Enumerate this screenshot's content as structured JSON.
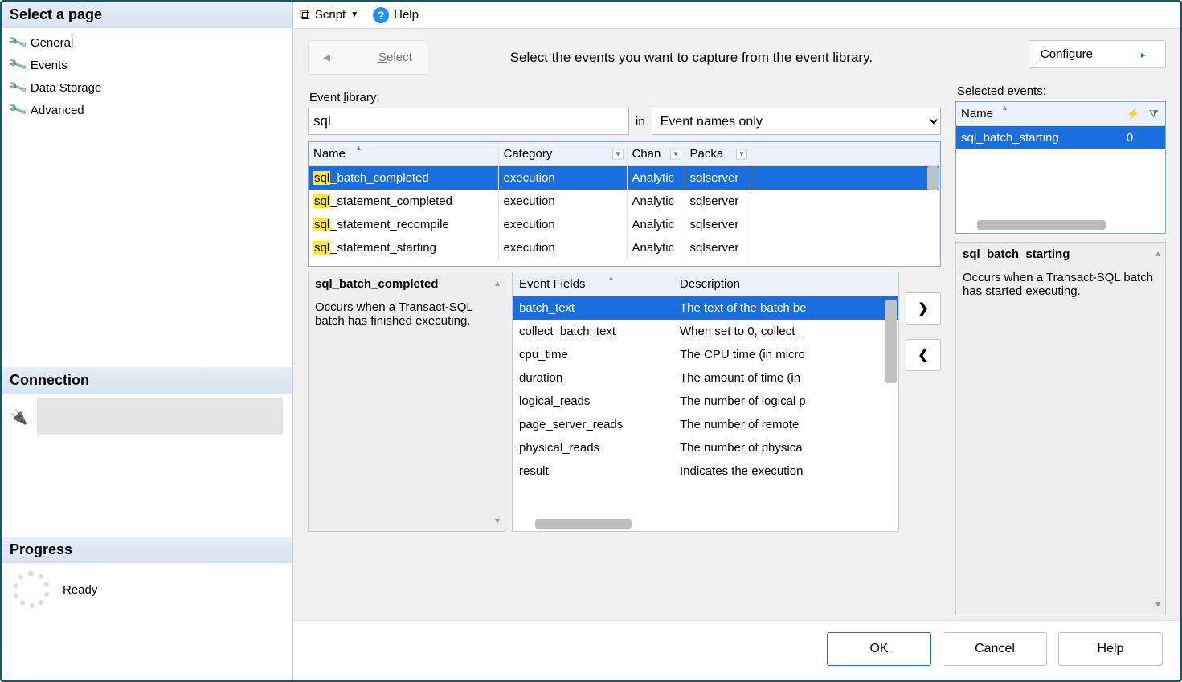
{
  "sidebar": {
    "title": "Select a page",
    "items": [
      {
        "label": "General"
      },
      {
        "label": "Events"
      },
      {
        "label": "Data Storage"
      },
      {
        "label": "Advanced"
      }
    ],
    "connection_title": "Connection",
    "progress_title": "Progress",
    "progress_text": "Ready"
  },
  "toolbar": {
    "script_label": "Script",
    "help_label": "Help"
  },
  "topline": {
    "select_btn": "Select",
    "instruction": "Select the events you want to capture from the event library.",
    "configure_btn": "Configure"
  },
  "library": {
    "label": "Event library:",
    "search_value": "sql",
    "in_label": "in",
    "scope_value": "Event names only",
    "cols": {
      "name": "Name",
      "category": "Category",
      "channel": "Chan",
      "package": "Packa"
    },
    "rows": [
      {
        "hl": "sql",
        "rest": "_batch_completed",
        "category": "execution",
        "channel": "Analytic",
        "package": "sqlserver",
        "selected": true
      },
      {
        "hl": "sql",
        "rest": "_statement_completed",
        "category": "execution",
        "channel": "Analytic",
        "package": "sqlserver",
        "selected": false
      },
      {
        "hl": "sql",
        "rest": "_statement_recompile",
        "category": "execution",
        "channel": "Analytic",
        "package": "sqlserver",
        "selected": false
      },
      {
        "hl": "sql",
        "rest": "_statement_starting",
        "category": "execution",
        "channel": "Analytic",
        "package": "sqlserver",
        "selected": false
      }
    ]
  },
  "desc_left": {
    "title": "sql_batch_completed",
    "text": "Occurs when a Transact-SQL batch has finished executing."
  },
  "fields": {
    "col1": "Event Fields",
    "col2": "Description",
    "rows": [
      {
        "name": "batch_text",
        "desc": "The text of the batch be",
        "selected": true
      },
      {
        "name": "collect_batch_text",
        "desc": "When set to 0, collect_"
      },
      {
        "name": "cpu_time",
        "desc": "The CPU time (in micro"
      },
      {
        "name": "duration",
        "desc": "The amount of time (in "
      },
      {
        "name": "logical_reads",
        "desc": "The number of logical p"
      },
      {
        "name": "page_server_reads",
        "desc": "The number of remote "
      },
      {
        "name": "physical_reads",
        "desc": "The number of physica"
      },
      {
        "name": "result",
        "desc": "Indicates the execution"
      }
    ]
  },
  "move": {
    "right": "❯",
    "left": "❮"
  },
  "selected": {
    "label": "Selected events:",
    "col_name": "Name",
    "rows": [
      {
        "name": "sql_batch_starting",
        "count": "0",
        "selected": true
      }
    ]
  },
  "desc_right": {
    "title": "sql_batch_starting",
    "text": "Occurs when a Transact-SQL batch has started executing."
  },
  "footer": {
    "ok": "OK",
    "cancel": "Cancel",
    "help": "Help"
  }
}
